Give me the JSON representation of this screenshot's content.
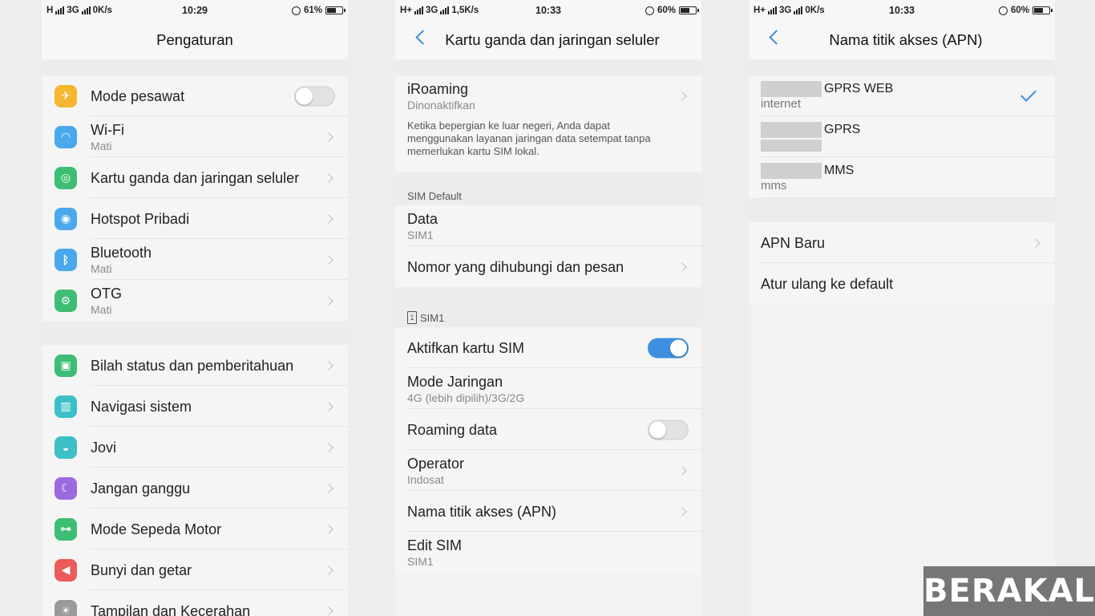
{
  "screens": [
    {
      "status": {
        "network_left": "H",
        "network_right": "3G",
        "speed": "0K/s",
        "time": "10:29",
        "battery": "61%",
        "battery_level": 0.61
      },
      "title": "Pengaturan",
      "group1": [
        {
          "title": "Mode pesawat",
          "subtitle": "",
          "icon": "airplane-icon",
          "color": "#f5b731",
          "control": "toggle-off"
        },
        {
          "title": "Wi-Fi",
          "subtitle": "Mati",
          "icon": "wifi-icon",
          "color": "#4aa8ec",
          "control": "chevron"
        },
        {
          "title": "Kartu ganda dan jaringan seluler",
          "subtitle": "",
          "icon": "globe-icon",
          "color": "#3dbe74",
          "control": "chevron"
        },
        {
          "title": "Hotspot Pribadi",
          "subtitle": "",
          "icon": "hotspot-icon",
          "color": "#4aa8ec",
          "control": "chevron"
        },
        {
          "title": "Bluetooth",
          "subtitle": "Mati",
          "icon": "bluetooth-icon",
          "color": "#4aa8ec",
          "control": "chevron"
        },
        {
          "title": "OTG",
          "subtitle": "Mati",
          "icon": "otg-icon",
          "color": "#3dbe74",
          "control": "chevron"
        }
      ],
      "group2": [
        {
          "title": "Bilah status dan pemberitahuan",
          "subtitle": "",
          "icon": "status-bar-icon",
          "color": "#3dbe74"
        },
        {
          "title": "Navigasi sistem",
          "subtitle": "",
          "icon": "navigation-icon",
          "color": "#3dbfc7"
        },
        {
          "title": "Jovi",
          "subtitle": "",
          "icon": "jovi-icon",
          "color": "#3dbfc7"
        },
        {
          "title": "Jangan ganggu",
          "subtitle": "",
          "icon": "moon-icon",
          "color": "#9b6ae0"
        },
        {
          "title": "Mode Sepeda Motor",
          "subtitle": "",
          "icon": "motorcycle-icon",
          "color": "#3dbe74"
        },
        {
          "title": "Bunyi dan getar",
          "subtitle": "",
          "icon": "sound-icon",
          "color": "#ec5b5b"
        },
        {
          "title": "Tampilan dan Kecerahan",
          "subtitle": "",
          "icon": "display-icon",
          "color": "#9a9a9a"
        }
      ]
    },
    {
      "status": {
        "network_left": "H+",
        "network_right": "3G",
        "speed": "1,5K/s",
        "time": "10:33",
        "battery": "60%",
        "battery_level": 0.6
      },
      "title": "Kartu ganda dan jaringan seluler",
      "iroaming": {
        "title": "iRoaming",
        "subtitle": "Dinonaktifkan",
        "description": "Ketika bepergian ke luar negeri, Anda dapat menggunakan layanan jaringan data setempat tanpa memerlukan kartu SIM lokal."
      },
      "sim_default_label": "SIM Default",
      "sim_default": [
        {
          "title": "Data",
          "subtitle": "SIM1",
          "control": "none"
        },
        {
          "title": "Nomor yang dihubungi dan pesan",
          "subtitle": "",
          "control": "chevron"
        }
      ],
      "sim1_label": "SIM1",
      "sim1_icon_text": "1",
      "sim1": [
        {
          "title": "Aktifkan kartu SIM",
          "subtitle": "",
          "control": "toggle-on"
        },
        {
          "title": "Mode Jaringan",
          "subtitle": "4G (lebih dipilih)/3G/2G",
          "control": "none"
        },
        {
          "title": "Roaming data",
          "subtitle": "",
          "control": "toggle-off"
        },
        {
          "title": "Operator",
          "subtitle": "Indosat",
          "control": "chevron"
        },
        {
          "title": "Nama titik akses (APN)",
          "subtitle": "",
          "control": "chevron"
        },
        {
          "title": "Edit SIM",
          "subtitle": "SIM1",
          "control": "none"
        }
      ]
    },
    {
      "status": {
        "network_left": "H+",
        "network_right": "3G",
        "speed": "0K/s",
        "time": "10:33",
        "battery": "60%",
        "battery_level": 0.6
      },
      "title": "Nama titik akses (APN)",
      "apns": [
        {
          "name": "GPRS WEB",
          "subtitle": "internet",
          "selected": true
        },
        {
          "name": "GPRS",
          "subtitle": "",
          "selected": false
        },
        {
          "name": "MMS",
          "subtitle": "mms",
          "selected": false
        }
      ],
      "actions": [
        {
          "title": "APN Baru",
          "control": "chevron"
        },
        {
          "title": "Atur ulang ke default",
          "control": "none"
        }
      ]
    }
  ],
  "watermark": "BERAKAL",
  "colors": {
    "accent": "#3e8fe0",
    "background": "#f2f2f2"
  }
}
